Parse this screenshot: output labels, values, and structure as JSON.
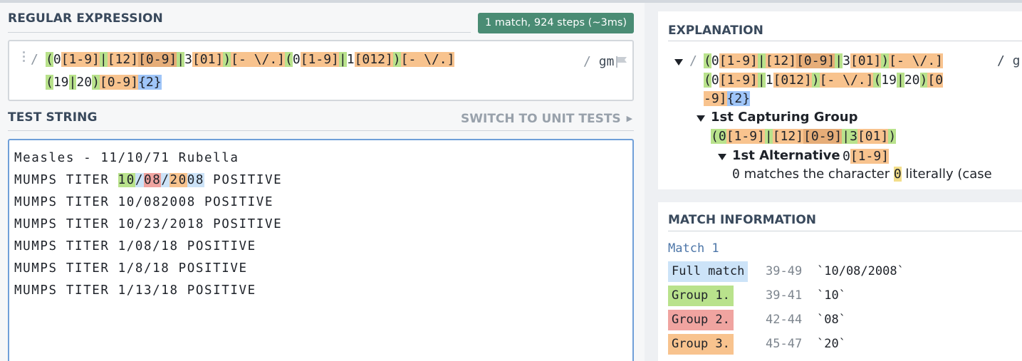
{
  "regex": {
    "section_title": "REGULAR EXPRESSION",
    "match_badge": "1 match, 924 steps (~3ms)",
    "open_delimiter": "/",
    "close_delimiter": "/",
    "flags": "gm",
    "tokens": {
      "t01": "(",
      "t02": "0",
      "t03": "[1-9]",
      "t04": "|",
      "t05": "[12]",
      "t06": "[0-9]",
      "t07": "|",
      "t08": "3",
      "t09": "[01]",
      "t10": ")",
      "t11": "[- \\/.]",
      "t12": "(",
      "t13": "0",
      "t14": "[1-9]",
      "t15": "|",
      "t16": "1",
      "t17": "[012]",
      "t18": ")",
      "t19": "[- \\/.]",
      "t20": "(",
      "t21": "19",
      "t22": "|",
      "t23": "20",
      "t24": ")",
      "t25": "[0-9]",
      "t26": "{2}"
    }
  },
  "test": {
    "section_title": "TEST STRING",
    "switch_link": "SWITCH TO UNIT TESTS",
    "line1": "Measles - 11/10/71 Rubella",
    "line2_prefix": "MUMPS TITER ",
    "line2_g1": "10",
    "line2_sep1": "/",
    "line2_g2": "08",
    "line2_sep2": "/",
    "line2_g3": "20",
    "line2_tail": "08",
    "line2_suffix": " POSITIVE",
    "line3": "MUMPS TITER 10/082008 POSITIVE",
    "line4": "MUMPS TITER 10/23/2018 POSITIVE",
    "line5": "MUMPS TITER 1/08/18 POSITIVE",
    "line6": "MUMPS TITER 1/8/18 POSITIVE",
    "line7": "MUMPS TITER 1/13/18 POSITIVE"
  },
  "explanation": {
    "title": "EXPLANATION",
    "slash": "/",
    "trailing": "/ g",
    "group_heading": "1st Capturing Group",
    "alt_heading": "1st Alternative",
    "alt_tokens": {
      "a1": "0",
      "a2": "[1-9]"
    },
    "desc_char": "0",
    "desc_text_1": " matches the character ",
    "desc_highlight": "0",
    "desc_text_2": " literally (case",
    "group_tokens": {
      "g01": "(",
      "g02": "0",
      "g03": "[1-9]",
      "g04": "|",
      "g05": "[12]",
      "g06": "[0-9]",
      "g07": "|",
      "g08": "3",
      "g09": "[01]",
      "g10": ")"
    },
    "line3": {
      "e01": "(",
      "e02": "0",
      "e03": "[1-9]",
      "e04": "|",
      "e05": "1",
      "e06": "[012]",
      "e07": ")",
      "e08": "[- \\/.]",
      "e09": "(",
      "e10": "19",
      "e11": "|",
      "e12": "20",
      "e13": ")",
      "e14": "[0"
    },
    "line4": {
      "f01": "-9]",
      "f02": "{2}"
    }
  },
  "match_info": {
    "title": "MATCH INFORMATION",
    "match_label": "Match 1",
    "rows": [
      {
        "label": "Full match",
        "range": "39-49",
        "value": "`10/08/2008`",
        "color": "#cce3f8"
      },
      {
        "label": "Group 1.",
        "range": "39-41",
        "value": "`10`",
        "color": "#b9e28c"
      },
      {
        "label": "Group 2.",
        "range": "42-44",
        "value": "`08`",
        "color": "#f0a4a0"
      },
      {
        "label": "Group 3.",
        "range": "45-47",
        "value": "`20`",
        "color": "#f8c38e"
      }
    ]
  },
  "colors": {
    "badge": "#4a8c74",
    "group_green": "#b9e28c",
    "class_orange": "#f8c38e",
    "quantifier_blue": "#9fc5f8",
    "title_slate": "#39495c"
  }
}
